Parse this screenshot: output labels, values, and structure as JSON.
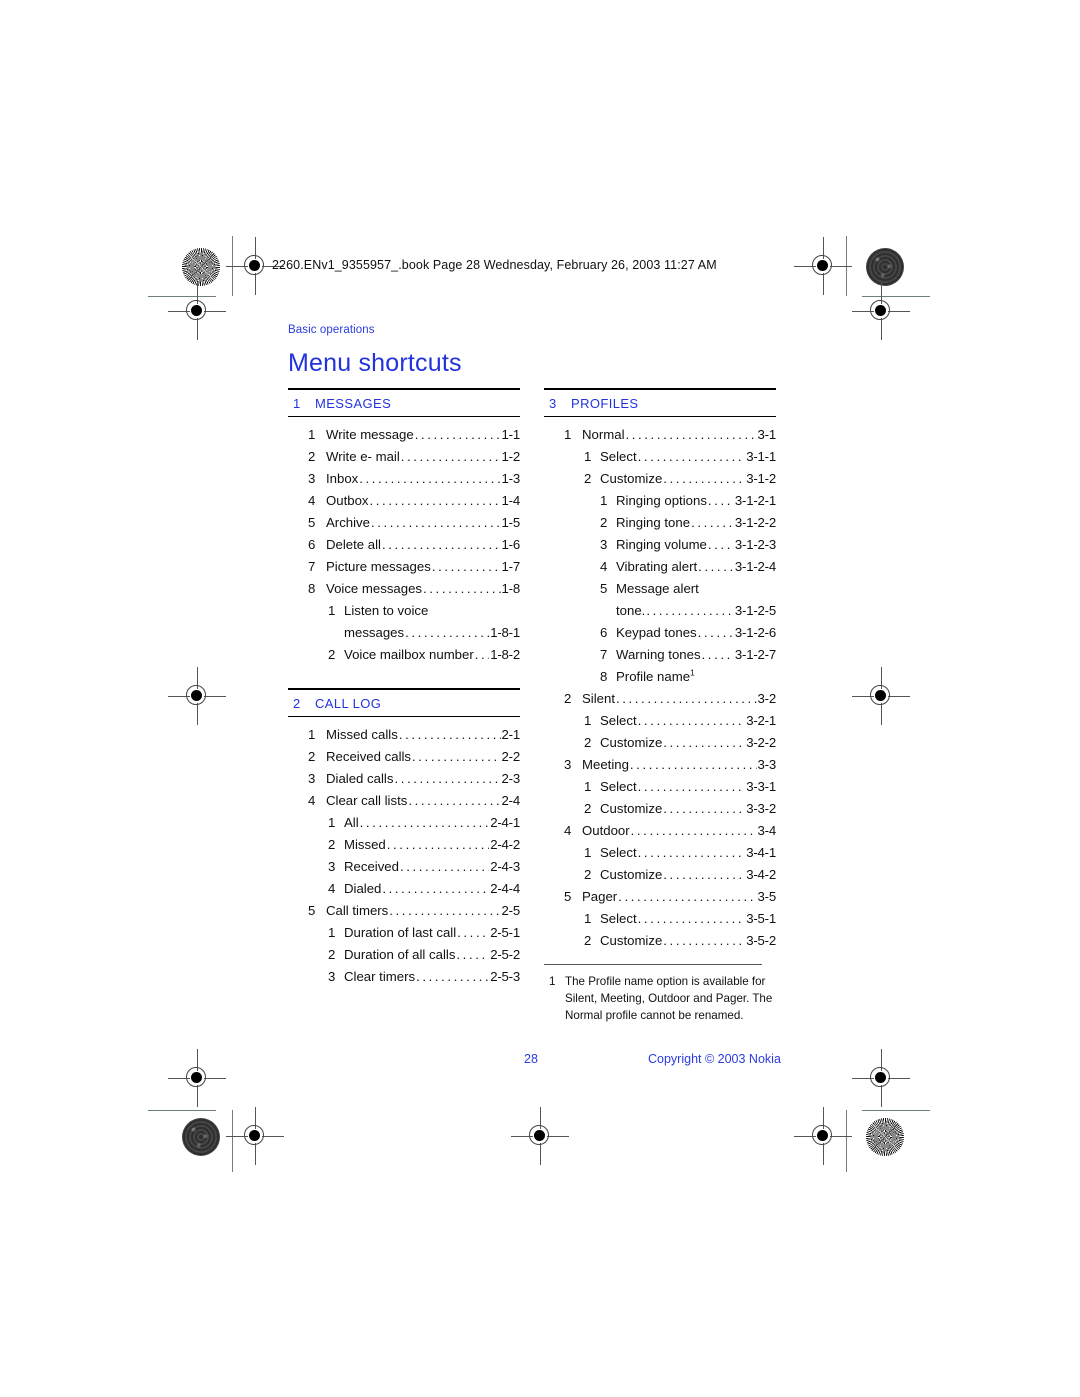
{
  "printer_marks": {
    "file_stamp": "2260.ENv1_9355957_.book  Page 28  Wednesday, February 26, 2003  11:27 AM"
  },
  "header": {
    "running_head": "Basic operations",
    "title": "Menu shortcuts"
  },
  "footer": {
    "page_number": "28",
    "copyright": "Copyright © 2003 Nokia"
  },
  "colors": {
    "accent_blue": "#2233dd",
    "text_black": "#111111"
  },
  "columns": {
    "left": [
      {
        "section_number": "1",
        "section_title": "MESSAGES",
        "entries": [
          {
            "level": 1,
            "num": "1",
            "label": "Write message",
            "page": "1-1"
          },
          {
            "level": 1,
            "num": "2",
            "label": "Write e- mail",
            "page": "1-2"
          },
          {
            "level": 1,
            "num": "3",
            "label": "Inbox",
            "page": "1-3"
          },
          {
            "level": 1,
            "num": "4",
            "label": "Outbox",
            "page": "1-4"
          },
          {
            "level": 1,
            "num": "5",
            "label": "Archive",
            "page": "1-5"
          },
          {
            "level": 1,
            "num": "6",
            "label": "Delete all",
            "page": "1-6"
          },
          {
            "level": 1,
            "num": "7",
            "label": "Picture messages",
            "page": "1-7"
          },
          {
            "level": 1,
            "num": "8",
            "label": "Voice messages",
            "page": "1-8"
          },
          {
            "level": 2,
            "num": "1",
            "label": "Listen to voice",
            "page": "",
            "no_leader": true
          },
          {
            "level": 2,
            "num": "",
            "label": "messages",
            "page": "1-8-1",
            "continuation": true
          },
          {
            "level": 2,
            "num": "2",
            "label": "Voice mailbox number",
            "page": "1-8-2"
          }
        ]
      },
      {
        "section_number": "2",
        "section_title": "CALL LOG",
        "entries": [
          {
            "level": 1,
            "num": "1",
            "label": "Missed calls",
            "page": "2-1"
          },
          {
            "level": 1,
            "num": "2",
            "label": "Received calls",
            "page": "2-2"
          },
          {
            "level": 1,
            "num": "3",
            "label": "Dialed calls",
            "page": "2-3"
          },
          {
            "level": 1,
            "num": "4",
            "label": "Clear call lists",
            "page": "2-4"
          },
          {
            "level": 2,
            "num": "1",
            "label": "All",
            "page": "2-4-1"
          },
          {
            "level": 2,
            "num": "2",
            "label": "Missed",
            "page": "2-4-2"
          },
          {
            "level": 2,
            "num": "3",
            "label": "Received",
            "page": "2-4-3"
          },
          {
            "level": 2,
            "num": "4",
            "label": "Dialed",
            "page": "2-4-4"
          },
          {
            "level": 1,
            "num": "5",
            "label": "Call timers",
            "page": "2-5"
          },
          {
            "level": 2,
            "num": "1",
            "label": "Duration of last call",
            "page": "2-5-1"
          },
          {
            "level": 2,
            "num": "2",
            "label": "Duration of all calls",
            "page": "2-5-2"
          },
          {
            "level": 2,
            "num": "3",
            "label": "Clear timers",
            "page": "2-5-3"
          }
        ]
      }
    ],
    "right": [
      {
        "section_number": "3",
        "section_title": "PROFILES",
        "entries": [
          {
            "level": 1,
            "num": "1",
            "label": "Normal",
            "page": "3-1"
          },
          {
            "level": 2,
            "num": "1",
            "label": "Select",
            "page": "3-1-1"
          },
          {
            "level": 2,
            "num": "2",
            "label": "Customize",
            "page": "3-1-2"
          },
          {
            "level": 3,
            "num": "1",
            "label": "Ringing options",
            "page": "3-1-2-1"
          },
          {
            "level": 3,
            "num": "2",
            "label": "Ringing tone",
            "page": "3-1-2-2"
          },
          {
            "level": 3,
            "num": "3",
            "label": "Ringing volume",
            "page": "3-1-2-3"
          },
          {
            "level": 3,
            "num": "4",
            "label": "Vibrating alert",
            "page": "3-1-2-4"
          },
          {
            "level": 3,
            "num": "5",
            "label": "Message alert",
            "page": "",
            "no_leader": true
          },
          {
            "level": 3,
            "num": "",
            "label": "tone.",
            "page": "3-1-2-5",
            "continuation": true
          },
          {
            "level": 3,
            "num": "6",
            "label": "Keypad tones",
            "page": "3-1-2-6"
          },
          {
            "level": 3,
            "num": "7",
            "label": "Warning tones",
            "page": "3-1-2-7"
          },
          {
            "level": 3,
            "num": "8",
            "label": "Profile name",
            "page": "",
            "footnote_ref": "1",
            "no_leader": true
          },
          {
            "level": 1,
            "num": "2",
            "label": "Silent",
            "page": "3-2"
          },
          {
            "level": 2,
            "num": "1",
            "label": "Select",
            "page": "3-2-1"
          },
          {
            "level": 2,
            "num": "2",
            "label": "Customize",
            "page": "3-2-2"
          },
          {
            "level": 1,
            "num": "3",
            "label": "Meeting",
            "page": "3-3"
          },
          {
            "level": 2,
            "num": "1",
            "label": "Select",
            "page": "3-3-1"
          },
          {
            "level": 2,
            "num": "2",
            "label": "Customize",
            "page": "3-3-2"
          },
          {
            "level": 1,
            "num": "4",
            "label": "Outdoor",
            "page": "3-4"
          },
          {
            "level": 2,
            "num": "1",
            "label": "Select",
            "page": "3-4-1"
          },
          {
            "level": 2,
            "num": "2",
            "label": "Customize",
            "page": "3-4-2"
          },
          {
            "level": 1,
            "num": "5",
            "label": "Pager",
            "page": "3-5"
          },
          {
            "level": 2,
            "num": "1",
            "label": "Select",
            "page": "3-5-1"
          },
          {
            "level": 2,
            "num": "2",
            "label": "Customize",
            "page": "3-5-2"
          }
        ]
      }
    ]
  },
  "footnote": {
    "number": "1",
    "text": "The Profile name option is available for Silent, Meeting, Outdoor and Pager. The Normal profile cannot be renamed."
  }
}
